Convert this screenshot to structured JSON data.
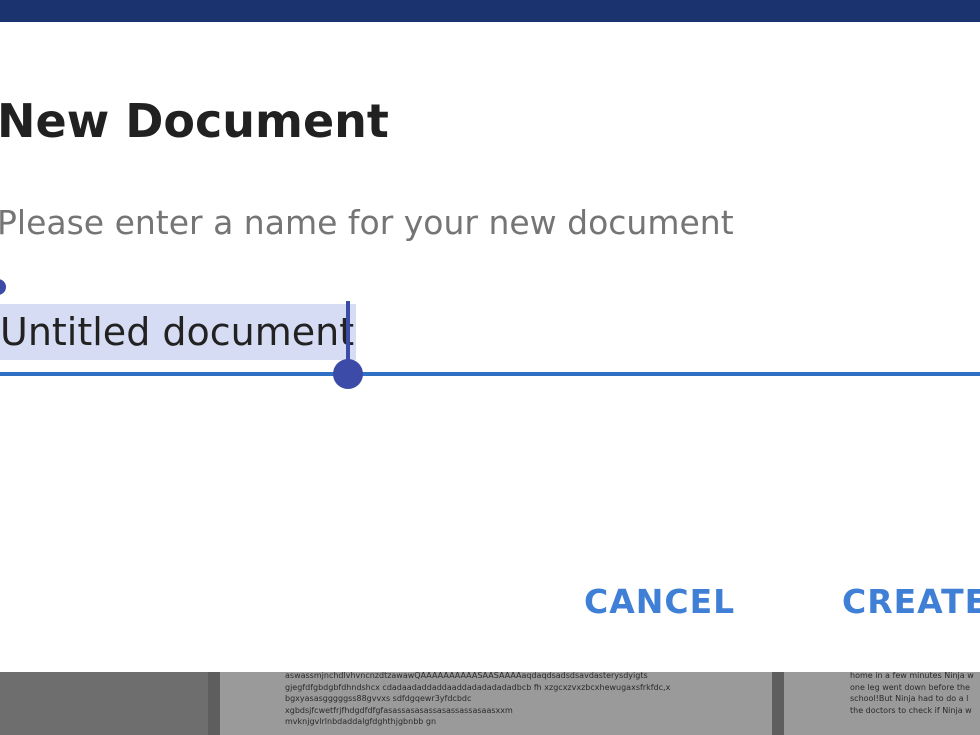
{
  "dialog": {
    "title": "New Document",
    "message": "Please enter a name for your new document",
    "input_value": "Untitled document",
    "cancel_label": "CANCEL",
    "create_label": "CREATE"
  },
  "background": {
    "page_center_lines": [
      "aswassmjnchdlvhvncnzdtzawawQAAAAAAAAAASAASAAAAaqdaqdsadsdsavdasterysdyigts",
      "gjegfdfgbdgbfdhndshcx cdadaadaddaddaaddadadadadadbcb fh xzgcxzvxzbcxhewugaxsfrkfdc,x",
      "bgxyasasgggggss88gvvxs sdfdgqewr3yfdcbdc",
      "xgbdsjfcwetfrjfhdgdfdfgfasassasasassasassassasaasxxm",
      "mvknjgvlrlnbdaddalgfdghthjgbnbb gn"
    ],
    "page_right_lines": [
      "home in a few minutes Ninja w",
      "one leg went down before the",
      "school!But Ninja had to do a l",
      "the doctors to check if Ninja w"
    ]
  },
  "colors": {
    "accent": "#3f7fd6",
    "selection": "#d6dcf3",
    "handle": "#3c4aa8",
    "top_bar": "#1b3470"
  }
}
